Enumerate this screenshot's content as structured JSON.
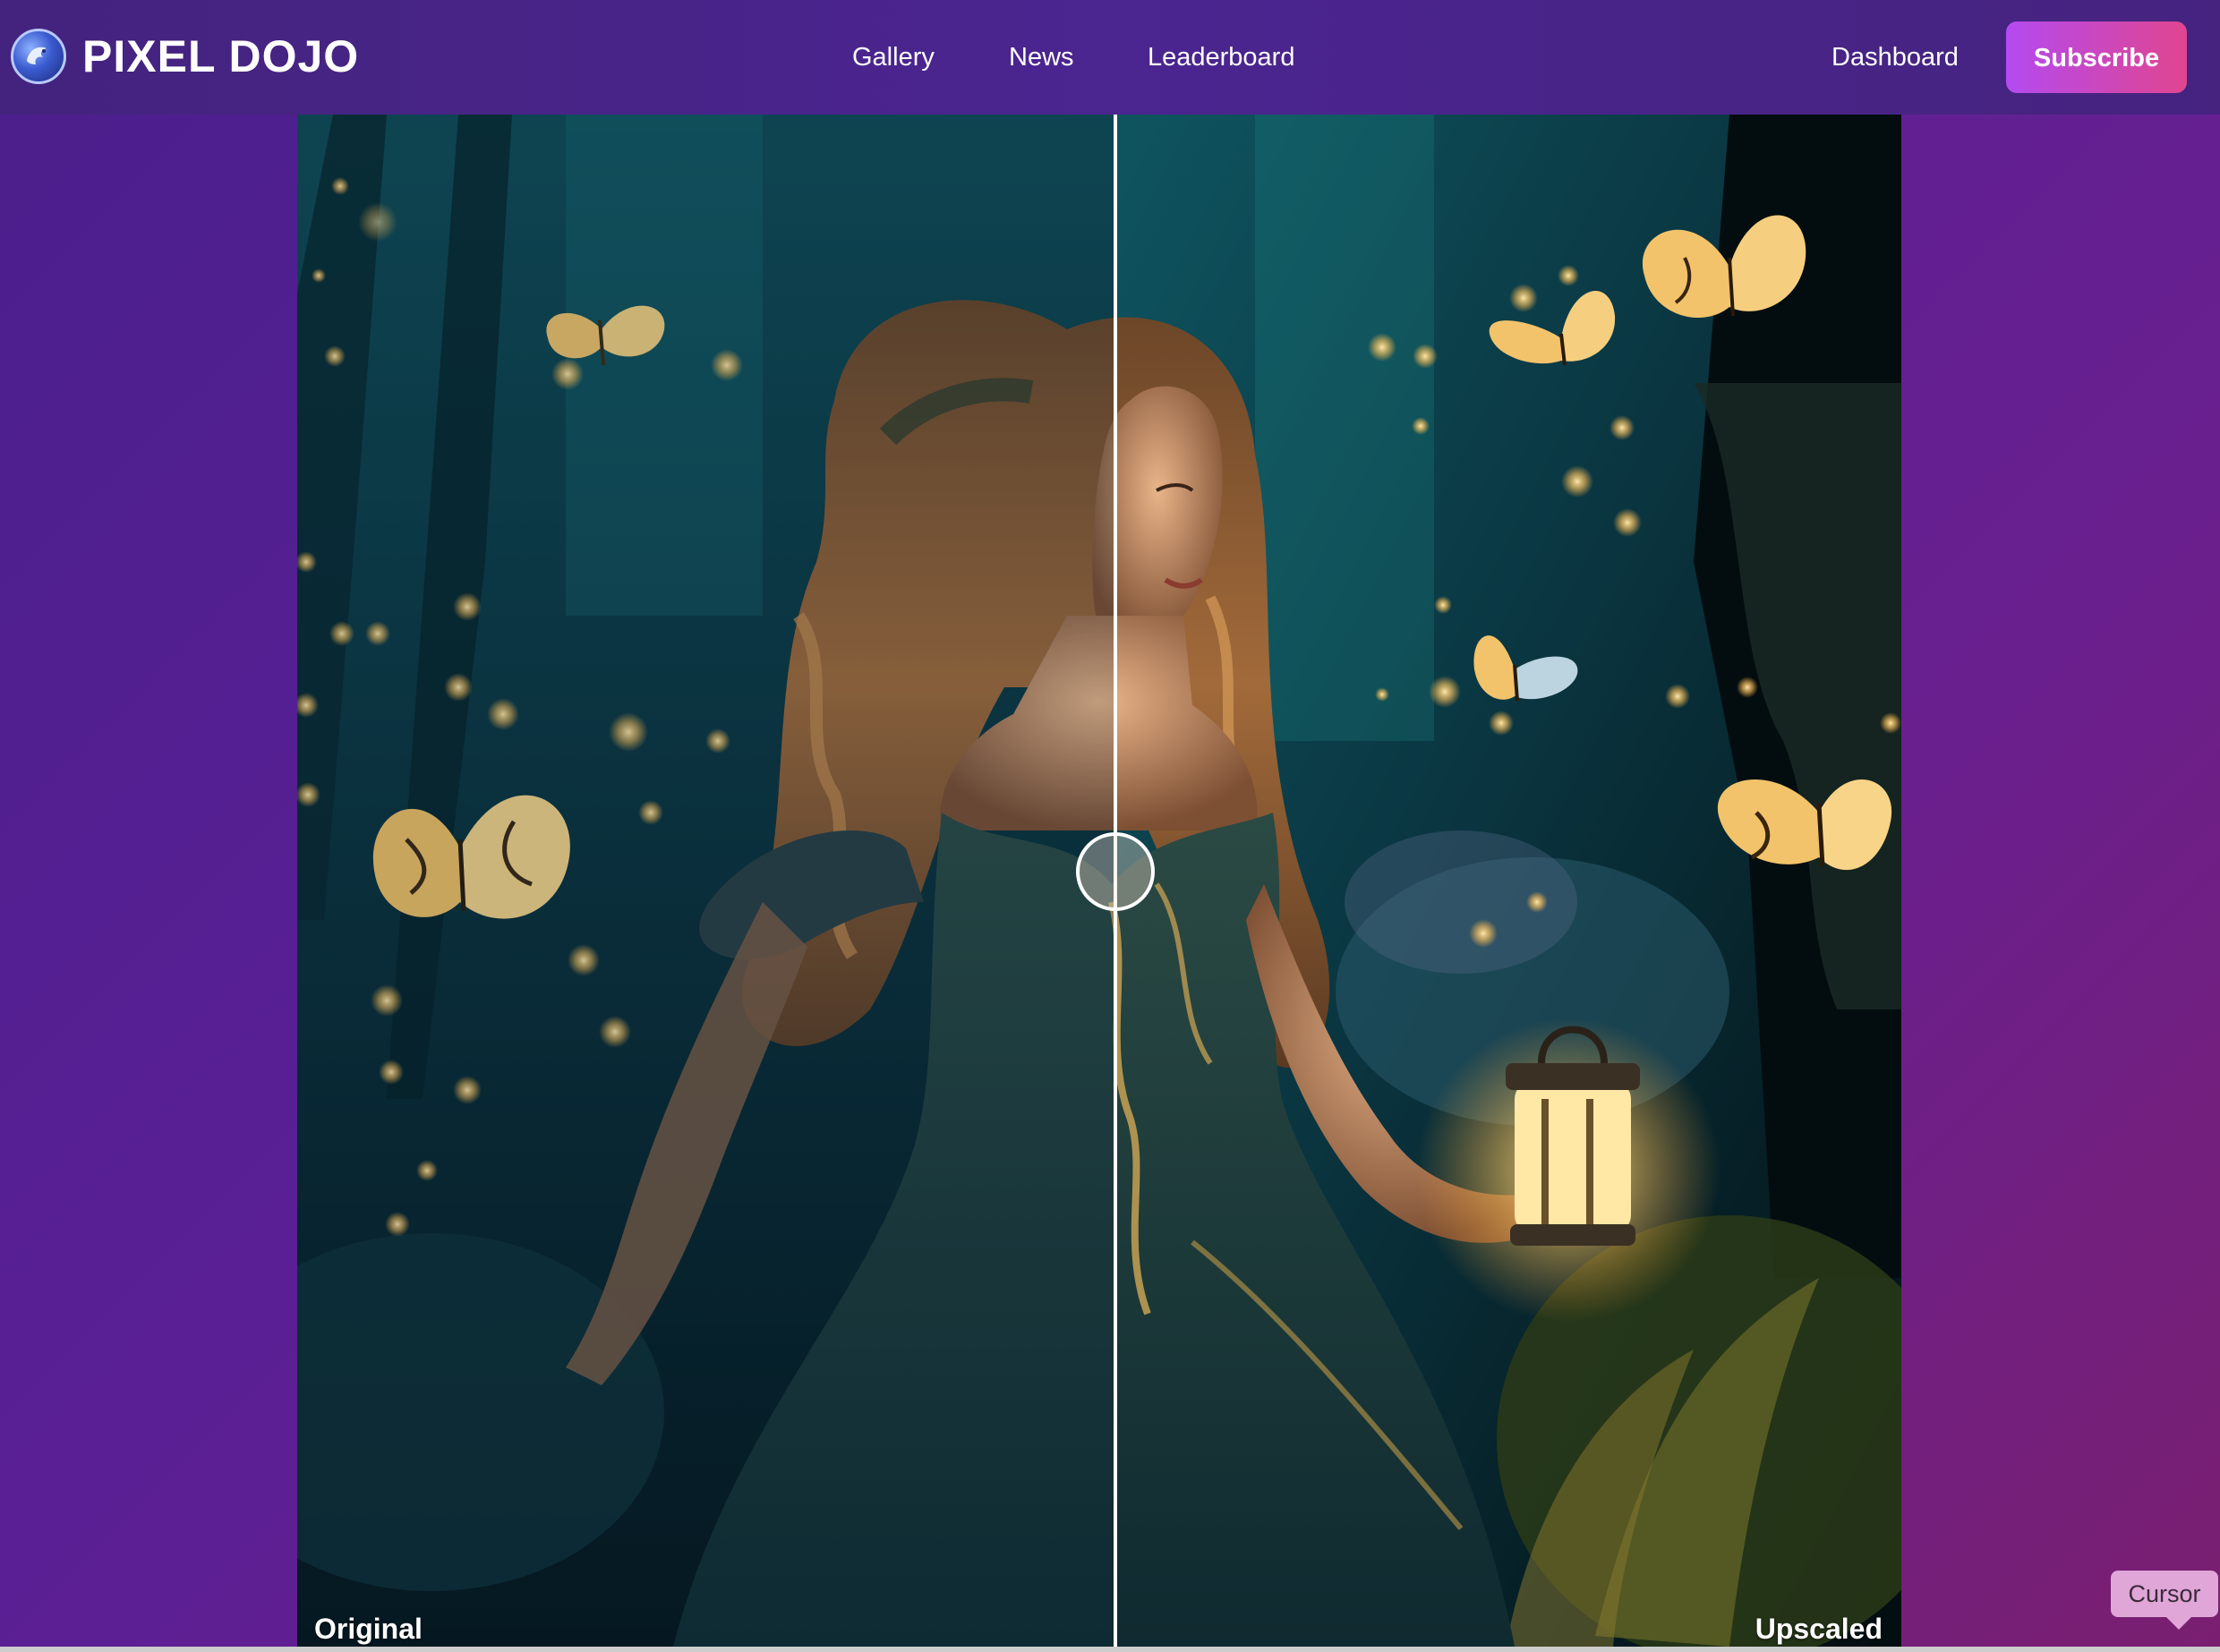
{
  "nav": {
    "brand": "PIXEL DOJO",
    "links": [
      {
        "label": "Gallery"
      },
      {
        "label": "News"
      },
      {
        "label": "Leaderboard"
      }
    ],
    "dashboard_label": "Dashboard",
    "subscribe_label": "Subscribe"
  },
  "comparison": {
    "left_label": "Original",
    "right_label": "Upscaled",
    "slider_position": 0.51
  },
  "tooltip": {
    "label": "Cursor"
  },
  "colors": {
    "background": "#5a1f95",
    "navbar": "#4b2590",
    "subscribe_start": "#b44af0",
    "subscribe_end": "#e0458f"
  },
  "icons": {
    "logo": "dragon-logo-icon"
  }
}
